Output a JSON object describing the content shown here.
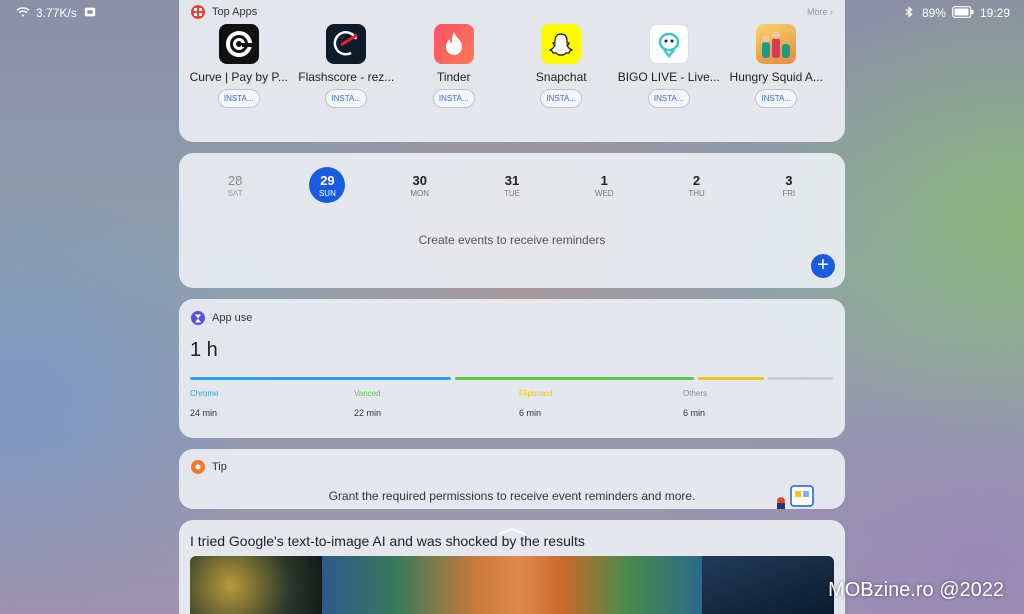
{
  "status_bar": {
    "network_speed": "3.77K/s",
    "battery": "89%",
    "time": "19:29"
  },
  "top_apps": {
    "title": "Top Apps",
    "more": "More",
    "apps": [
      {
        "name": "Curve | Pay by P...",
        "button": "INSTA..."
      },
      {
        "name": "Flashscore - rez...",
        "button": "INSTA..."
      },
      {
        "name": "Tinder",
        "button": "INSTA..."
      },
      {
        "name": "Snapchat",
        "button": "INSTA..."
      },
      {
        "name": "BIGO LIVE - Live...",
        "button": "INSTA..."
      },
      {
        "name": "Hungry Squid A...",
        "button": "INSTA..."
      }
    ]
  },
  "calendar": {
    "days": [
      {
        "num": "28",
        "wd": "SAT"
      },
      {
        "num": "29",
        "wd": "SUN"
      },
      {
        "num": "30",
        "wd": "MON"
      },
      {
        "num": "31",
        "wd": "TUE"
      },
      {
        "num": "1",
        "wd": "WED"
      },
      {
        "num": "2",
        "wd": "THU"
      },
      {
        "num": "3",
        "wd": "FRI"
      }
    ],
    "message": "Create events to receive reminders",
    "add": "+"
  },
  "app_use": {
    "title": "App use",
    "total": "1 h",
    "apps": [
      {
        "name": "Chrome",
        "time": "24 min",
        "minutes": 24,
        "color": "#2aa4e6"
      },
      {
        "name": "Vanced",
        "time": "22 min",
        "minutes": 22,
        "color": "#5cc84a"
      },
      {
        "name": "Flipboard",
        "time": "6 min",
        "minutes": 6,
        "color": "#f2c318"
      },
      {
        "name": "Others",
        "time": "6 min",
        "minutes": 6,
        "color": "#c9cdd2"
      }
    ]
  },
  "tip": {
    "title": "Tip",
    "text": "Grant the required permissions to receive event reminders and more."
  },
  "article": {
    "title": "I tried Google's text-to-image AI and was shocked by the results"
  },
  "watermark": "MOBzine.ro @2022",
  "colors": {
    "accent": "#1a5be0",
    "top_apps_icon": "#e2473a",
    "app_use_icon": "#5b55d6",
    "tip_icon": "#f07a2a"
  }
}
